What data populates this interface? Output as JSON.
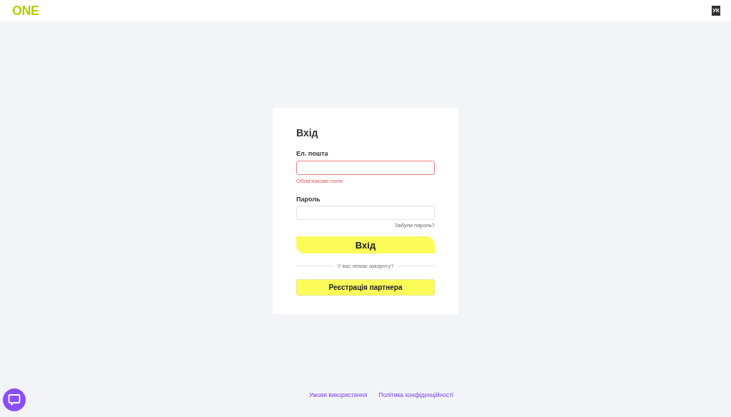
{
  "header": {
    "logo": "ONE",
    "language": "УК"
  },
  "form": {
    "title": "Вхід",
    "email": {
      "label": "Ел. пошта",
      "error": "Обов'язкове поле",
      "invalid": true
    },
    "password": {
      "label": "Пароль",
      "invalid": false
    },
    "forgot_link": "Забули пароль?",
    "submit": "Вхід",
    "divider_text": "У вас немає аккаунту?",
    "register": "Реєстрація партнера"
  },
  "footer": {
    "links": [
      "Умови використання",
      "Політика конфіденційності"
    ]
  }
}
